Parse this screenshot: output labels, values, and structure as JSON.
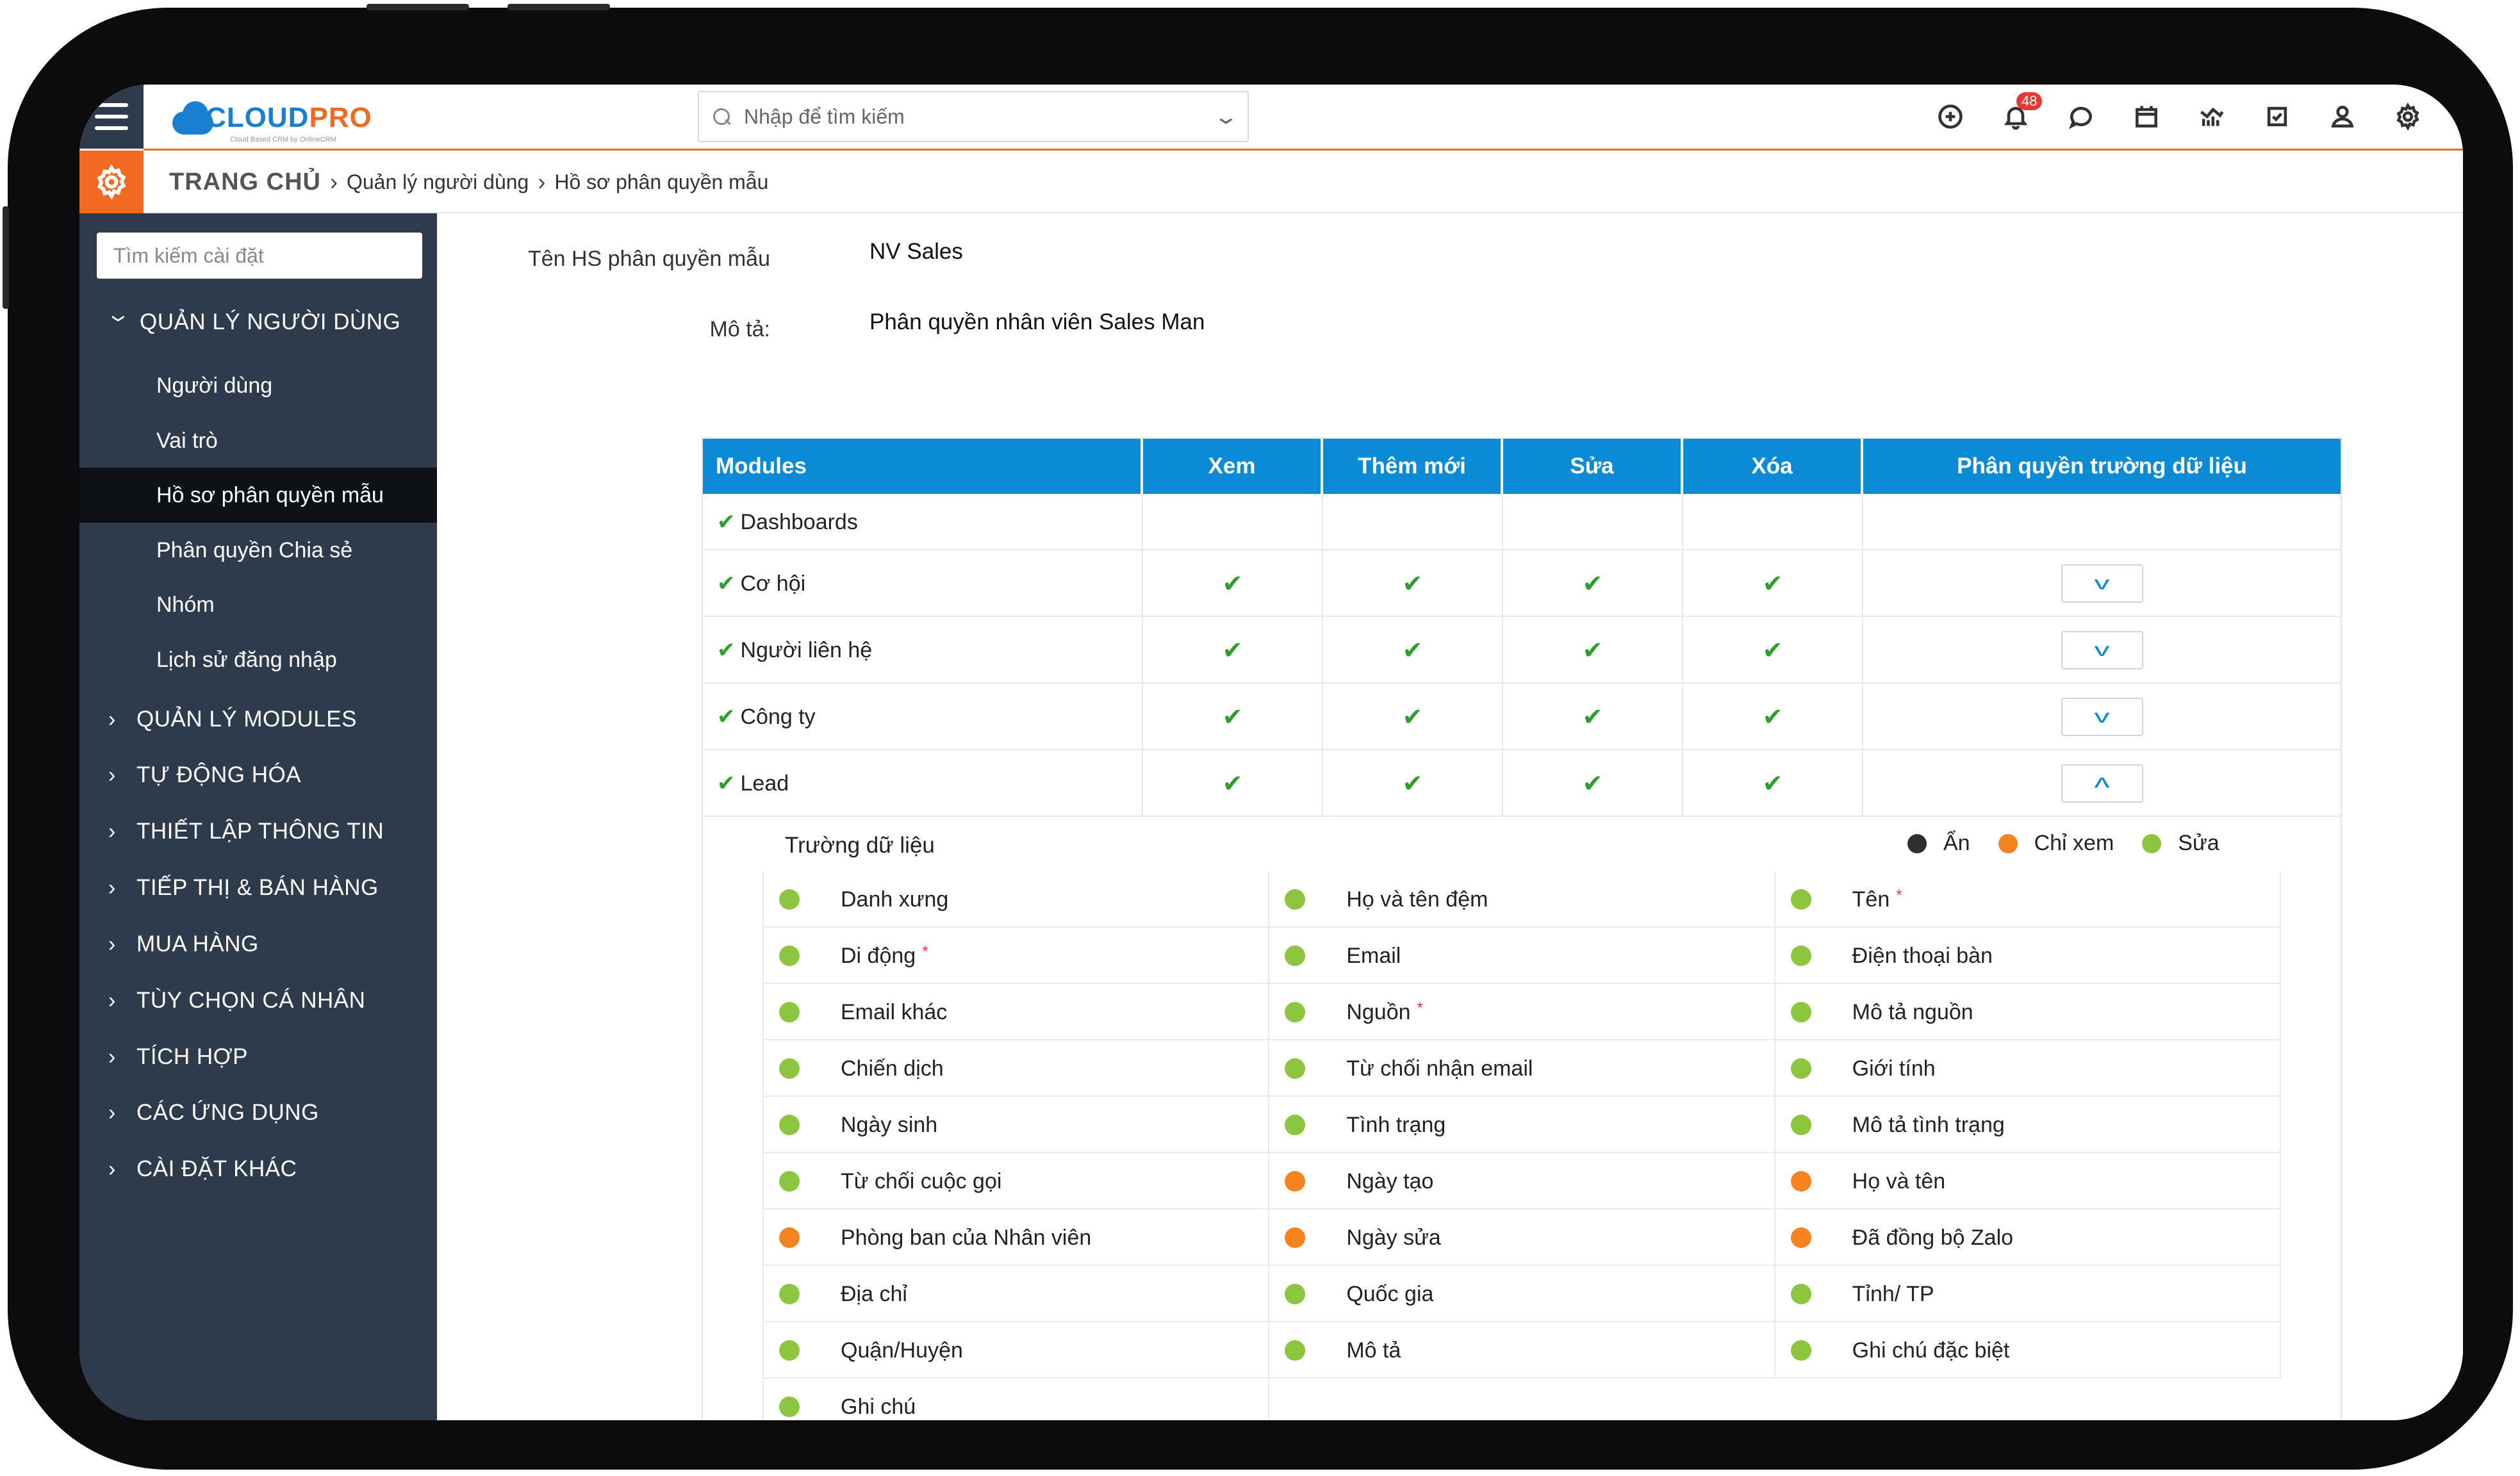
{
  "app": {
    "logo_primary": "CLOUD",
    "logo_secondary": "PRO",
    "logo_tagline": "Cloud Based CRM by OnlineCRM"
  },
  "search": {
    "placeholder": "Nhập để tìm kiếm"
  },
  "notifications": {
    "count": "48"
  },
  "header_icons": [
    "plus-circle-icon",
    "bell-icon",
    "chat-icon",
    "calendar-icon",
    "report-chart-icon",
    "checkbox-icon",
    "user-icon",
    "gear-icon"
  ],
  "breadcrumb": {
    "home": "TRANG CHỦ",
    "level1": "Quản lý người dùng",
    "level2": "Hồ sơ phân quyền mẫu"
  },
  "sidebar": {
    "search_placeholder": "Tìm kiếm cài đặt",
    "open_section": "QUẢN LÝ NGƯỜI DÙNG",
    "items": [
      {
        "label": "Người dùng",
        "active": false
      },
      {
        "label": "Vai trò",
        "active": false
      },
      {
        "label": "Hồ sơ phân quyền mẫu",
        "active": true
      },
      {
        "label": "Phân quyền Chia sẻ",
        "active": false
      },
      {
        "label": "Nhóm",
        "active": false
      },
      {
        "label": "Lịch sử đăng nhập",
        "active": false
      }
    ],
    "sections": [
      "QUẢN LÝ MODULES",
      "TỰ ĐỘNG HÓA",
      "THIẾT LẬP THÔNG TIN",
      "TIẾP THỊ & BÁN HÀNG",
      "MUA HÀNG",
      "TÙY CHỌN CÁ NHÂN",
      "TÍCH HỢP",
      "CÁC ỨNG DỤNG",
      "CÀI ĐẶT KHÁC"
    ]
  },
  "profile": {
    "name_label": "Tên HS phân quyền mẫu",
    "name_value": "NV Sales",
    "desc_label": "Mô tả:",
    "desc_value": "Phân quyền nhân viên Sales Man"
  },
  "permissions": {
    "columns": [
      "Modules",
      "Xem",
      "Thêm mới",
      "Sửa",
      "Xóa",
      "Phân quyền trường dữ liệu"
    ],
    "rows": [
      {
        "module": "Dashboards",
        "view": false,
        "create": false,
        "edit": false,
        "delete": false,
        "field_toggle": "none"
      },
      {
        "module": "Cơ hội",
        "view": true,
        "create": true,
        "edit": true,
        "delete": true,
        "field_toggle": "collapsed"
      },
      {
        "module": "Người liên hệ",
        "view": true,
        "create": true,
        "edit": true,
        "delete": true,
        "field_toggle": "collapsed"
      },
      {
        "module": "Công ty",
        "view": true,
        "create": true,
        "edit": true,
        "delete": true,
        "field_toggle": "collapsed"
      },
      {
        "module": "Lead",
        "view": true,
        "create": true,
        "edit": true,
        "delete": true,
        "field_toggle": "expanded"
      }
    ]
  },
  "fields_section": {
    "title": "Trường dữ liệu",
    "legend": [
      {
        "label": "Ẩn",
        "color": "#2f2f2f"
      },
      {
        "label": "Chỉ xem",
        "color": "#f5841f"
      },
      {
        "label": "Sửa",
        "color": "#8cc63f"
      }
    ],
    "fields": [
      {
        "label": "Danh xưng",
        "state": "edit",
        "required": false
      },
      {
        "label": "Họ và tên đệm",
        "state": "edit",
        "required": false
      },
      {
        "label": "Tên",
        "state": "edit",
        "required": true
      },
      {
        "label": "Di động",
        "state": "edit",
        "required": true
      },
      {
        "label": "Email",
        "state": "edit",
        "required": false
      },
      {
        "label": "Điện thoại bàn",
        "state": "edit",
        "required": false
      },
      {
        "label": "Email khác",
        "state": "edit",
        "required": false
      },
      {
        "label": "Nguồn",
        "state": "edit",
        "required": true
      },
      {
        "label": "Mô tả nguồn",
        "state": "edit",
        "required": false
      },
      {
        "label": "Chiến dịch",
        "state": "edit",
        "required": false
      },
      {
        "label": "Từ chối nhận email",
        "state": "edit",
        "required": false
      },
      {
        "label": "Giới tính",
        "state": "edit",
        "required": false
      },
      {
        "label": "Ngày sinh",
        "state": "edit",
        "required": false
      },
      {
        "label": "Tình trạng",
        "state": "edit",
        "required": false
      },
      {
        "label": "Mô tả tình trạng",
        "state": "edit",
        "required": false
      },
      {
        "label": "Từ chối cuộc gọi",
        "state": "edit",
        "required": false
      },
      {
        "label": "Ngày tạo",
        "state": "readonly",
        "required": false
      },
      {
        "label": "Họ và tên",
        "state": "readonly",
        "required": false
      },
      {
        "label": "Phòng ban của Nhân viên",
        "state": "readonly",
        "required": false
      },
      {
        "label": "Ngày sửa",
        "state": "readonly",
        "required": false
      },
      {
        "label": "Đã đồng bộ Zalo",
        "state": "readonly",
        "required": false
      },
      {
        "label": "Địa chỉ",
        "state": "edit",
        "required": false
      },
      {
        "label": "Quốc gia",
        "state": "edit",
        "required": false
      },
      {
        "label": "Tỉnh/ TP",
        "state": "edit",
        "required": false
      },
      {
        "label": "Quận/Huyện",
        "state": "edit",
        "required": false
      },
      {
        "label": "Mô tả",
        "state": "edit",
        "required": false
      },
      {
        "label": "Ghi chú đặc biệt",
        "state": "edit",
        "required": false
      },
      {
        "label": "Ghi chú",
        "state": "edit",
        "required": false
      }
    ]
  },
  "colors": {
    "sidebar_bg": "#2e3b4c",
    "accent_orange": "#f26a21",
    "header_blue": "#0b8bd6",
    "check_green": "#2e9e2e",
    "dot_hidden": "#2f2f2f",
    "dot_readonly": "#f5841f",
    "dot_edit": "#8cc63f"
  }
}
